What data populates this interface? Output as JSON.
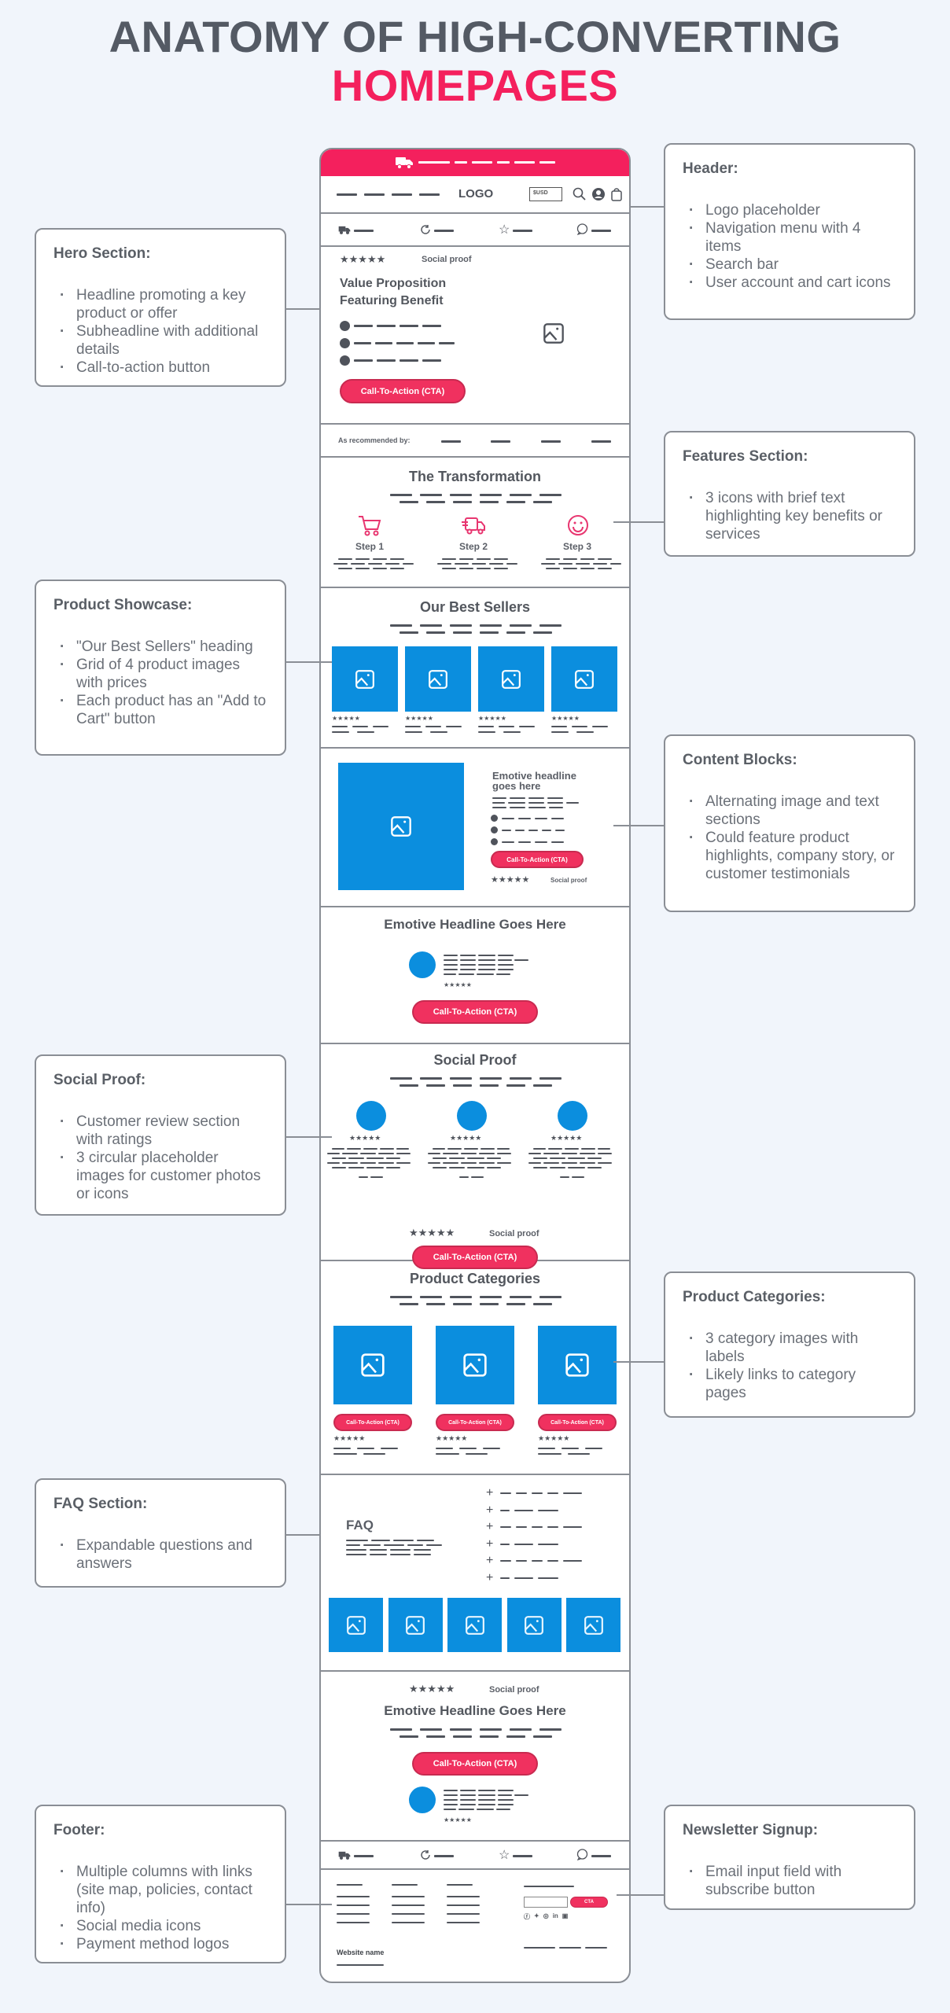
{
  "title": {
    "line1": "ANATOMY OF HIGH-CONVERTING",
    "line2": "HOMEPAGES"
  },
  "colors": {
    "accent": "#f4205d",
    "image_placeholder": "#0b8ede",
    "text_dark": "#545a64",
    "border": "#8a8e95",
    "background": "#f1f5fb"
  },
  "mockup": {
    "announcement_bar": {
      "icon": "truck-icon"
    },
    "header": {
      "logo": "LOGO",
      "currency": "$USD",
      "icons": [
        "search-icon",
        "user-icon",
        "cart-icon"
      ],
      "nav_items": 4
    },
    "usp_bar": {
      "icons": [
        "truck-icon",
        "refresh-icon",
        "star-icon",
        "chat-icon"
      ]
    },
    "hero": {
      "social_proof": "Social proof",
      "headline_line1": "Value Proposition",
      "headline_line2": "Featuring Benefit",
      "bullets": 3,
      "cta": "Call-To-Action (CTA)",
      "image_icon": "image-icon"
    },
    "recommended": {
      "label": "As recommended by:",
      "logos": 4
    },
    "transformation": {
      "heading": "The Transformation",
      "steps": [
        {
          "label": "Step 1",
          "icon": "cart-icon"
        },
        {
          "label": "Step 2",
          "icon": "delivery-truck-icon"
        },
        {
          "label": "Step 3",
          "icon": "smiley-icon"
        }
      ]
    },
    "best_sellers": {
      "heading": "Our Best Sellers",
      "products": 4
    },
    "content_block": {
      "headline": "Emotive headline goes here",
      "cta": "Call-To-Action (CTA)",
      "social_proof": "Social proof"
    },
    "testimonial": {
      "headline": "Emotive Headline Goes Here",
      "cta": "Call-To-Action (CTA)"
    },
    "social_proof": {
      "heading": "Social Proof",
      "reviews": 3,
      "social_proof": "Social proof",
      "cta": "Call-To-Action (CTA)"
    },
    "categories": {
      "heading": "Product Categories",
      "items": [
        {
          "cta": "Call-To-Action (CTA)"
        },
        {
          "cta": "Call-To-Action (CTA)"
        },
        {
          "cta": "Call-To-Action (CTA)"
        }
      ]
    },
    "faq": {
      "heading": "FAQ",
      "questions": 6,
      "gallery_images": 5
    },
    "final_cta": {
      "social_proof": "Social proof",
      "headline": "Emotive Headline Goes Here",
      "cta": "Call-To-Action (CTA)"
    },
    "footer": {
      "newsletter_cta": "CTA",
      "website_name": "Website name",
      "social_icons": [
        "facebook-icon",
        "twitter-icon",
        "instagram-icon",
        "linkedin-icon",
        "youtube-icon"
      ]
    }
  },
  "annotations": {
    "header": {
      "title": "Header:",
      "items": [
        "Logo placeholder",
        "Navigation menu with 4 items",
        "Search bar",
        "User account and cart icons"
      ]
    },
    "hero": {
      "title": "Hero Section:",
      "items": [
        "Headline promoting a key product or offer",
        "Subheadline with additional details",
        "Call-to-action button"
      ]
    },
    "features": {
      "title": "Features Section:",
      "items": [
        "3 icons with brief text highlighting key benefits or services"
      ]
    },
    "showcase": {
      "title": "Product Showcase:",
      "items": [
        "\"Our Best Sellers\" heading",
        "Grid of 4 product images with prices",
        "Each product has an \"Add to Cart\" button"
      ]
    },
    "content": {
      "title": "Content Blocks:",
      "items": [
        "Alternating image and text sections",
        "Could feature product highlights, company story, or customer testimonials"
      ]
    },
    "social": {
      "title": "Social Proof:",
      "items": [
        "Customer review section with ratings",
        "3 circular placeholder images for customer photos or icons"
      ]
    },
    "categories": {
      "title": "Product Categories:",
      "items": [
        "3 category images with labels",
        "Likely links to category pages"
      ]
    },
    "faq": {
      "title": "FAQ Section:",
      "items": [
        "Expandable questions and answers"
      ]
    },
    "footer": {
      "title": "Footer:",
      "items": [
        "Multiple columns with links (site map, policies, contact info)",
        "Social media icons",
        "Payment method logos"
      ]
    },
    "newsletter": {
      "title": "Newsletter Signup:",
      "items": [
        "Email input field with subscribe button"
      ]
    }
  }
}
